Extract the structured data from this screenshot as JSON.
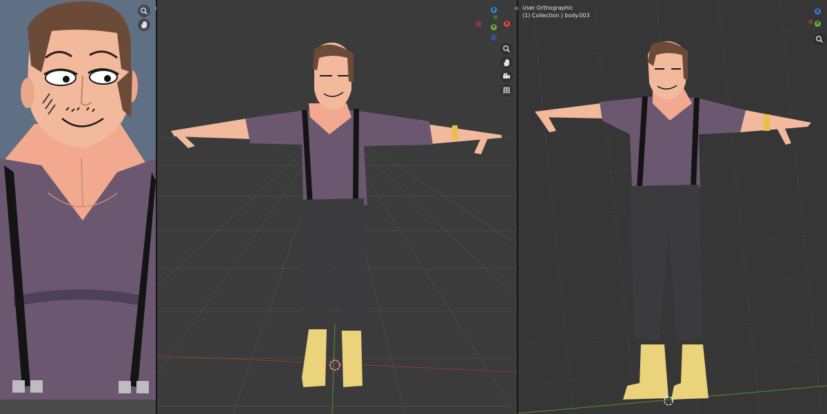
{
  "viewport_right": {
    "view_name": "User Orthographic",
    "collection_info": "(1) Collection | body.003"
  },
  "gizmo": {
    "axes": [
      "X",
      "Y",
      "Z"
    ],
    "colors": {
      "x": "#e04a4a",
      "y": "#6cb33a",
      "z": "#3f7fd8"
    }
  },
  "nav_tools": [
    "zoom-icon",
    "hand-pan-icon",
    "camera-icon",
    "grid-ortho-icon"
  ],
  "scene_colors": {
    "viewport_bg": "#3b3b3b",
    "grid": "#454545",
    "skin": "#f2b99c",
    "shirt": "#6b5870",
    "pants": "#3b3a3d",
    "boots": "#ead37a",
    "hair": "#6b4a38",
    "suspenders": "#141414",
    "left_bg": "#5f6f84"
  }
}
